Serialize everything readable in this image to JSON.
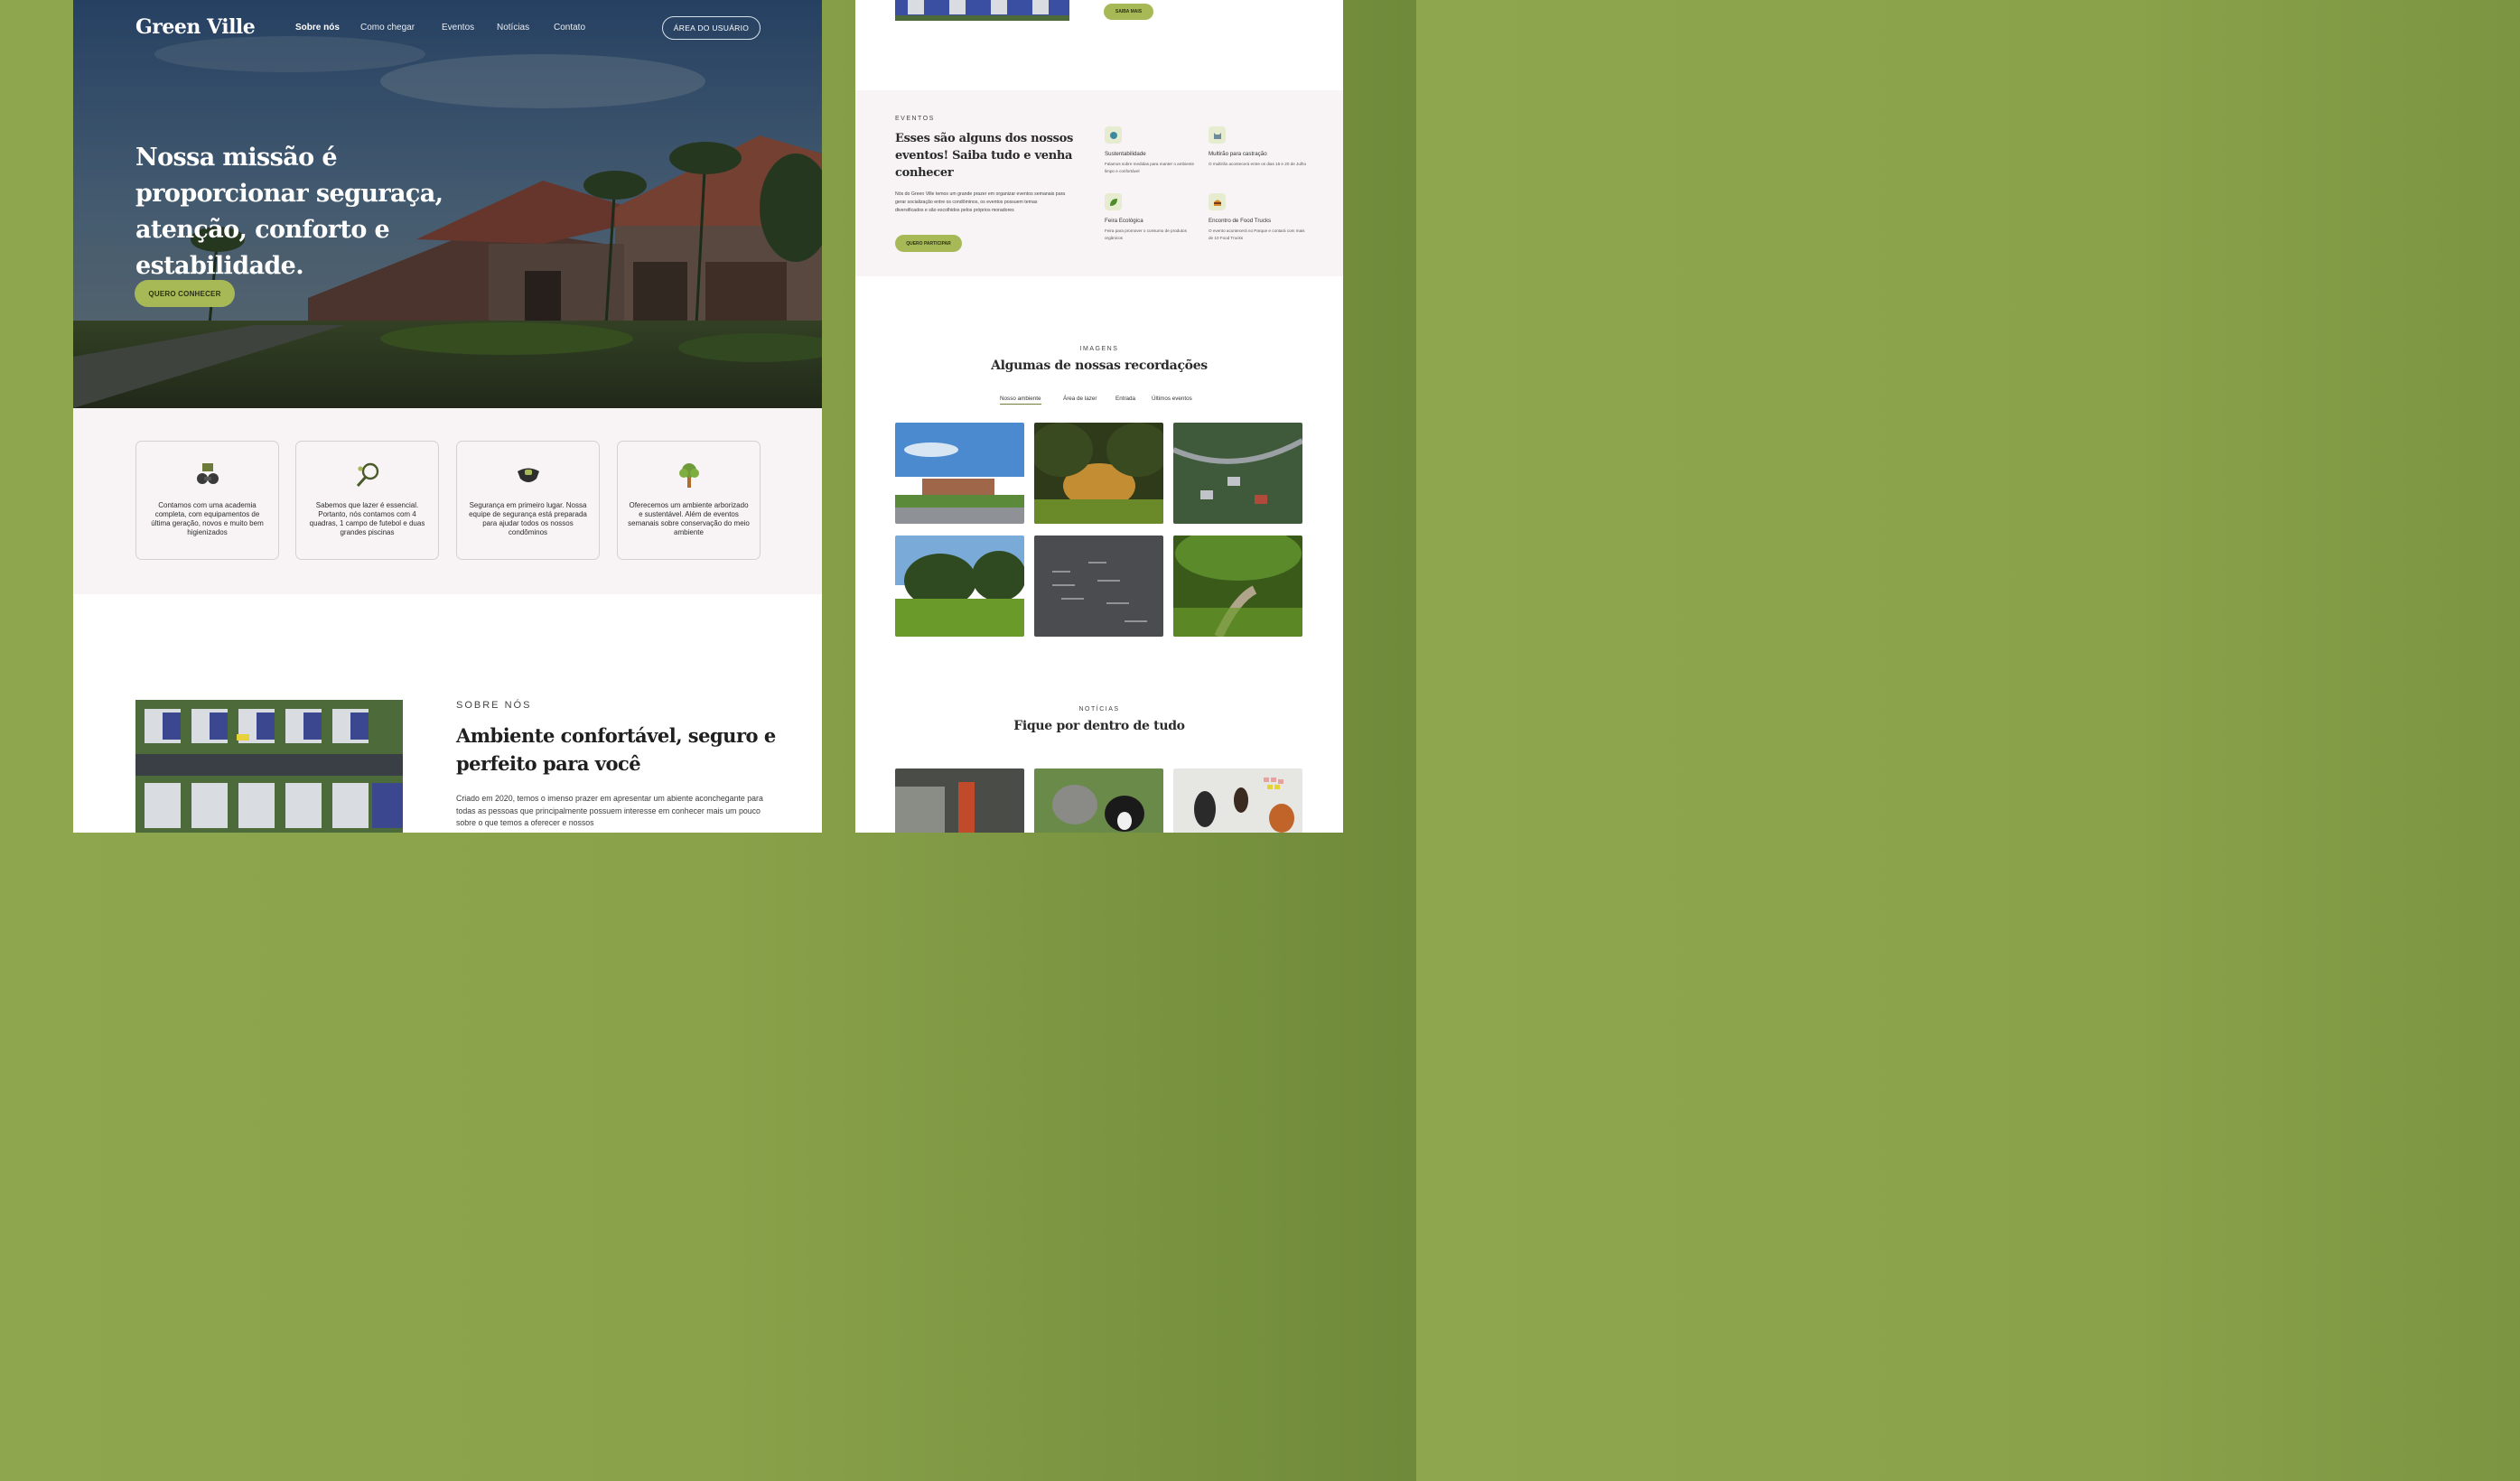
{
  "left": {
    "logo": "Green Ville",
    "nav": [
      {
        "label": "Sobre nós",
        "active": true
      },
      {
        "label": "Como chegar",
        "active": false
      },
      {
        "label": "Eventos",
        "active": false
      },
      {
        "label": "Notícias",
        "active": false
      },
      {
        "label": "Contato",
        "active": false
      }
    ],
    "user_button": "ÁREA DO USUÁRIO",
    "hero_title": "Nossa missão é proporcionar seguraça, atenção, conforto e estabilidade.",
    "hero_cta": "QUERO CONHECER",
    "features": [
      {
        "icon": "dumbbell-icon",
        "text": "Contamos com uma academia completa, com equipamentos de última geração, novos e muito bem higienizados"
      },
      {
        "icon": "tennis-racket-icon",
        "text": "Sabemos que lazer é essencial. Portanto, nós contamos com 4 quadras, 1 campo de futebol e duas grandes piscinas"
      },
      {
        "icon": "security-guard-icon",
        "text": "Segurança em primeiro lugar. Nossa equipe de segurança está preparada para ajudar todos os nossos condôminos"
      },
      {
        "icon": "tree-icon",
        "text": "Oferecemos um ambiente arborizado e sustentável. Além de eventos semanais sobre conservação do meio ambiente"
      }
    ],
    "about": {
      "kicker": "SOBRE NÓS",
      "title": "Ambiente confortável, seguro e perfeito para você",
      "text": "Criado em 2020, temos o imenso prazer em apresentar um abiente aconchegante para todas as pessoas que principalmente possuem interesse em conhecer mais um pouco sobre o que temos a oferecer e nossos"
    }
  },
  "right": {
    "top_button": "SAIBA MAIS",
    "events": {
      "kicker": "EVENTOS",
      "title": "Esses são alguns dos nossos eventos! Saiba tudo e venha conhecer",
      "text": "Nós do Green Ville temos um grande prazer em organizar eventos semanais para gerar socialização entre os condôminos, os eventos possuem temas diversificados e são escolhidos pelos próprios moradores",
      "button": "QUERO PARTICIPAR",
      "items": [
        {
          "icon": "globe-icon",
          "title": "Sustentabilidade",
          "text": "Falamos sobre medidas para manter o ambiente limpo e confortável"
        },
        {
          "icon": "cat-icon",
          "title": "Multirão para castração",
          "text": "O multirão acontecerá entre os dias 15 e 20 de Julho"
        },
        {
          "icon": "leaf-icon",
          "title": "Feira Ecológica",
          "text": "Feira para promover o consumo de produtos orgânicos"
        },
        {
          "icon": "burger-icon",
          "title": "Encontro de Food Trucks",
          "text": "O evento acontecerá no Parque e contará com mais de 10 Food Trucks"
        }
      ]
    },
    "gallery": {
      "kicker": "IMAGENS",
      "title": "Algumas de nossas recordações",
      "tabs": [
        "Nosso ambiente",
        "Área de lazer",
        "Entrada",
        "Últimos eventos"
      ]
    },
    "news": {
      "kicker": "NOTÍCIAS",
      "title": "Fique por dentro de tudo"
    }
  }
}
